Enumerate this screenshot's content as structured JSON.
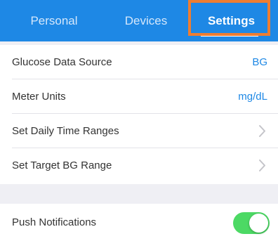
{
  "colors": {
    "tabbar_bg": "#1e88e5",
    "accent": "#1e88e5",
    "highlight": "#ee7d31",
    "toggle_on": "#4cd964"
  },
  "tabs": [
    {
      "label": "Personal",
      "active": false
    },
    {
      "label": "Devices",
      "active": false
    },
    {
      "label": "Settings",
      "active": true
    }
  ],
  "settings": {
    "glucose_source": {
      "label": "Glucose Data Source",
      "value": "BG"
    },
    "meter_units": {
      "label": "Meter Units",
      "value": "mg/dL"
    },
    "daily_time_ranges": {
      "label": "Set Daily Time Ranges",
      "icon": "chevron-right-icon"
    },
    "target_bg_range": {
      "label": "Set Target BG Range",
      "icon": "chevron-right-icon"
    },
    "push_notifications": {
      "label": "Push Notifications",
      "enabled": true
    }
  }
}
